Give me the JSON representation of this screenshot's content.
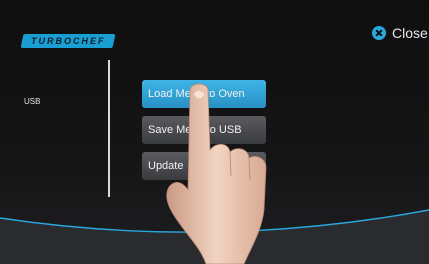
{
  "header": {
    "logo_text": "TURBOCHEF",
    "close_label": "Close"
  },
  "sidebar": {
    "items": [
      {
        "label": "USB"
      }
    ]
  },
  "menu": {
    "buttons": [
      {
        "label": "Load Menu to Oven",
        "active": true
      },
      {
        "label": "Save Menu to USB",
        "active": false
      },
      {
        "label": "Update",
        "active": false
      }
    ]
  },
  "colors": {
    "accent": "#2aa7de",
    "background": "#101011",
    "button_active": "#35a7dc",
    "button_idle": "#4a4b4e"
  }
}
